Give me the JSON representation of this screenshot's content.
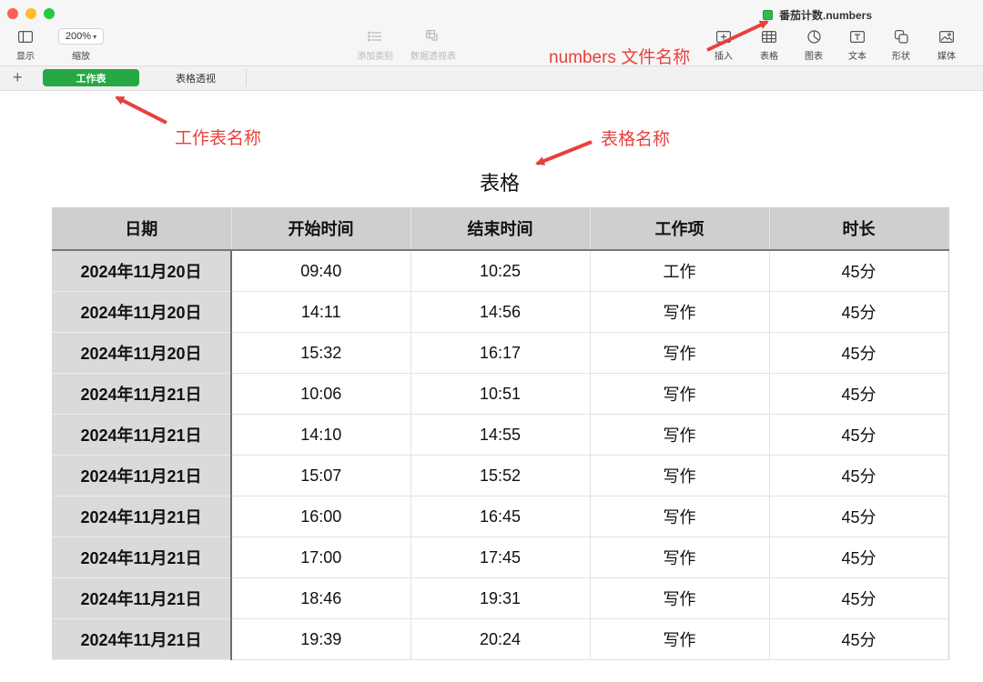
{
  "window": {
    "title": "番茄计数.numbers"
  },
  "toolbar": {
    "left": [
      {
        "id": "display",
        "label": "显示",
        "icon": "sidebar-icon"
      },
      {
        "id": "zoom",
        "label": "缩放",
        "value": "200%"
      }
    ],
    "center": [
      {
        "id": "add-category",
        "label": "添加类别",
        "icon": "list-icon",
        "enabled": false
      },
      {
        "id": "pivot",
        "label": "数据透视表",
        "icon": "pivot-icon",
        "enabled": false
      }
    ],
    "right": [
      {
        "id": "insert",
        "label": "插入",
        "icon": "insert-icon"
      },
      {
        "id": "table",
        "label": "表格",
        "icon": "table-icon"
      },
      {
        "id": "chart",
        "label": "图表",
        "icon": "chart-icon"
      },
      {
        "id": "text",
        "label": "文本",
        "icon": "text-icon"
      },
      {
        "id": "shape",
        "label": "形状",
        "icon": "shape-icon"
      },
      {
        "id": "media",
        "label": "媒体",
        "icon": "media-icon"
      }
    ]
  },
  "sheets": {
    "add_symbol": "+",
    "active": "工作表",
    "tabs": [
      "表格透视"
    ]
  },
  "table": {
    "title": "表格",
    "headers": [
      "日期",
      "开始时间",
      "结束时间",
      "工作项",
      "时长"
    ],
    "rows": [
      [
        "2024年11月20日",
        "09:40",
        "10:25",
        "工作",
        "45分"
      ],
      [
        "2024年11月20日",
        "14:11",
        "14:56",
        "写作",
        "45分"
      ],
      [
        "2024年11月20日",
        "15:32",
        "16:17",
        "写作",
        "45分"
      ],
      [
        "2024年11月21日",
        "10:06",
        "10:51",
        "写作",
        "45分"
      ],
      [
        "2024年11月21日",
        "14:10",
        "14:55",
        "写作",
        "45分"
      ],
      [
        "2024年11月21日",
        "15:07",
        "15:52",
        "写作",
        "45分"
      ],
      [
        "2024年11月21日",
        "16:00",
        "16:45",
        "写作",
        "45分"
      ],
      [
        "2024年11月21日",
        "17:00",
        "17:45",
        "写作",
        "45分"
      ],
      [
        "2024年11月21日",
        "18:46",
        "19:31",
        "写作",
        "45分"
      ],
      [
        "2024年11月21日",
        "19:39",
        "20:24",
        "写作",
        "45分"
      ]
    ]
  },
  "annotations": {
    "file_name": "numbers 文件名称",
    "sheet_name": "工作表名称",
    "table_name": "表格名称",
    "color": "#e7413c"
  },
  "colors": {
    "accent": "#28a745",
    "header_bg": "#cfcfcf",
    "date_col_bg": "#dadada"
  }
}
